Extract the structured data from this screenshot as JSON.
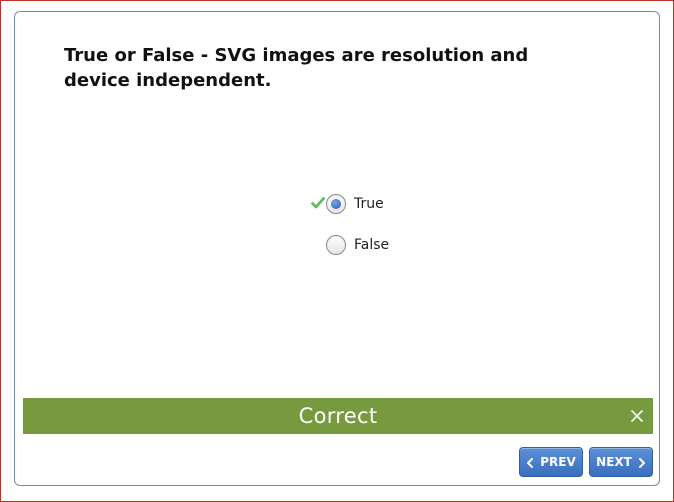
{
  "question": {
    "text": "True or False - SVG images are resolution and device independent."
  },
  "options": [
    {
      "label": "True",
      "selected": true,
      "marked_correct": true
    },
    {
      "label": "False",
      "selected": false,
      "marked_correct": false
    }
  ],
  "feedback": {
    "text": "Correct",
    "color": "#789a3e"
  },
  "navigation": {
    "prev_label": "PREV",
    "next_label": "NEXT"
  },
  "colors": {
    "accent": "#3a6fbf",
    "frame": "#c0312b",
    "card_border": "#6f8fb5",
    "check": "#4caf50"
  }
}
